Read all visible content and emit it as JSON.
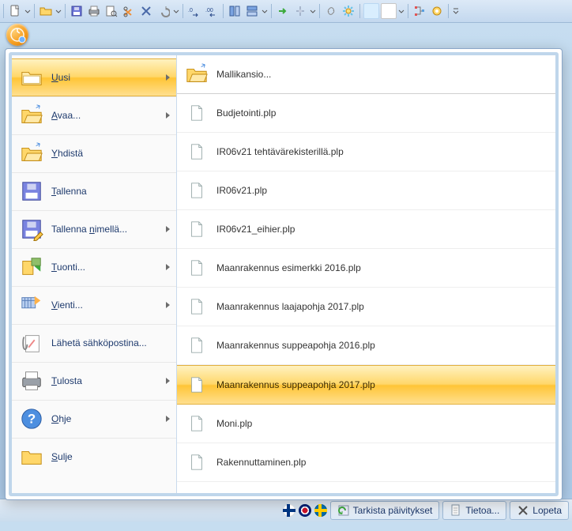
{
  "menu": {
    "items": [
      {
        "label": "Uusi",
        "hotkey": "U",
        "hasSub": true,
        "active": true,
        "icon": "folder"
      },
      {
        "label": "Avaa...",
        "hotkey": "A",
        "hasSub": true,
        "icon": "folder-arrow"
      },
      {
        "label": "Yhdistä",
        "hotkey": "Y",
        "hasSub": false,
        "icon": "folder-arrow"
      },
      {
        "label": "Tallenna",
        "hotkey": "T",
        "hasSub": false,
        "icon": "floppy"
      },
      {
        "label": "Tallenna nimellä...",
        "hotkey": "n",
        "hasSub": true,
        "icon": "floppy-pencil"
      },
      {
        "label": "Tuonti...",
        "hotkey": "T",
        "hasSub": true,
        "icon": "import"
      },
      {
        "label": "Vienti...",
        "hotkey": "V",
        "hasSub": true,
        "icon": "export"
      },
      {
        "label": "Lähetä sähköpostina...",
        "hotkey": "",
        "hasSub": false,
        "icon": "mail"
      },
      {
        "label": "Tulosta",
        "hotkey": "T",
        "hasSub": true,
        "icon": "printer"
      },
      {
        "label": "Ohje",
        "hotkey": "O",
        "hasSub": true,
        "icon": "help"
      },
      {
        "label": "Sulje",
        "hotkey": "S",
        "hasSub": false,
        "icon": "folder"
      }
    ]
  },
  "files": [
    {
      "label": "Mallikansio...",
      "icon": "folder-arrow"
    },
    {
      "label": "Budjetointi.plp",
      "icon": "page"
    },
    {
      "label": "IR06v21 tehtävärekisterillä.plp",
      "icon": "page"
    },
    {
      "label": "IR06v21.plp",
      "icon": "page"
    },
    {
      "label": "IR06v21_eihier.plp",
      "icon": "page"
    },
    {
      "label": "Maanrakennus esimerkki 2016.plp",
      "icon": "page"
    },
    {
      "label": "Maanrakennus laajapohja 2017.plp",
      "icon": "page"
    },
    {
      "label": "Maanrakennus suppeapohja 2016.plp",
      "icon": "page"
    },
    {
      "label": "Maanrakennus suppeapohja 2017.plp",
      "icon": "page",
      "hovered": true
    },
    {
      "label": "Moni.plp",
      "icon": "page"
    },
    {
      "label": "Rakennuttaminen.plp",
      "icon": "page"
    }
  ],
  "status": {
    "updates": "Tarkista päivitykset",
    "about": "Tietoa...",
    "quit": "Lopeta"
  },
  "toolbar_icons": [
    "page",
    "folder-arrow",
    "floppy",
    "printer",
    "preview",
    "scissors",
    "x",
    "undo",
    "dec0",
    "dec00",
    "col1",
    "col2",
    "arrow-right",
    "split",
    "link",
    "gear",
    "swatch-light",
    "swatch-white",
    "swatch-small",
    "tree",
    "cog",
    "dropdown"
  ]
}
